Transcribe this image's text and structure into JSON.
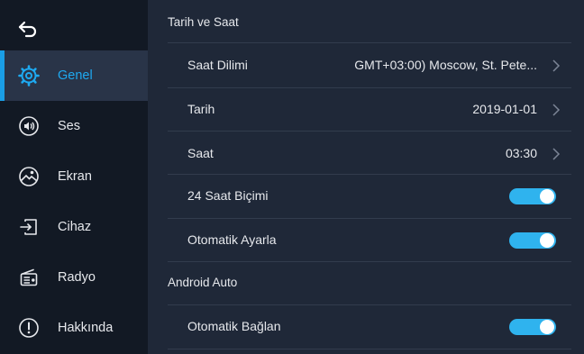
{
  "sidebar": {
    "items": [
      {
        "label": "Genel",
        "icon": "gear-icon",
        "active": true
      },
      {
        "label": "Ses",
        "icon": "speaker-icon",
        "active": false
      },
      {
        "label": "Ekran",
        "icon": "display-icon",
        "active": false
      },
      {
        "label": "Cihaz",
        "icon": "device-icon",
        "active": false
      },
      {
        "label": "Radyo",
        "icon": "radio-icon",
        "active": false
      },
      {
        "label": "Hakkında",
        "icon": "info-icon",
        "active": false
      }
    ]
  },
  "sections": {
    "datetime_title": "Tarih ve Saat",
    "android_title": "Android Auto"
  },
  "rows": {
    "timezone": {
      "label": "Saat Dilimi",
      "value": "GMT+03:00) Moscow, St. Pete..."
    },
    "date": {
      "label": "Tarih",
      "value": "2019-01-01"
    },
    "time": {
      "label": "Saat",
      "value": "03:30"
    },
    "format24": {
      "label": "24 Saat Biçimi",
      "on": true
    },
    "auto_adjust": {
      "label": "Otomatik Ayarla",
      "on": true
    },
    "auto_connect": {
      "label": "Otomatik Bağlan",
      "on": true
    }
  },
  "colors": {
    "accent": "#1ea9f0",
    "toggle_on": "#2fb3ee",
    "sidebar_bg": "#121924",
    "main_bg": "#1f2838"
  }
}
